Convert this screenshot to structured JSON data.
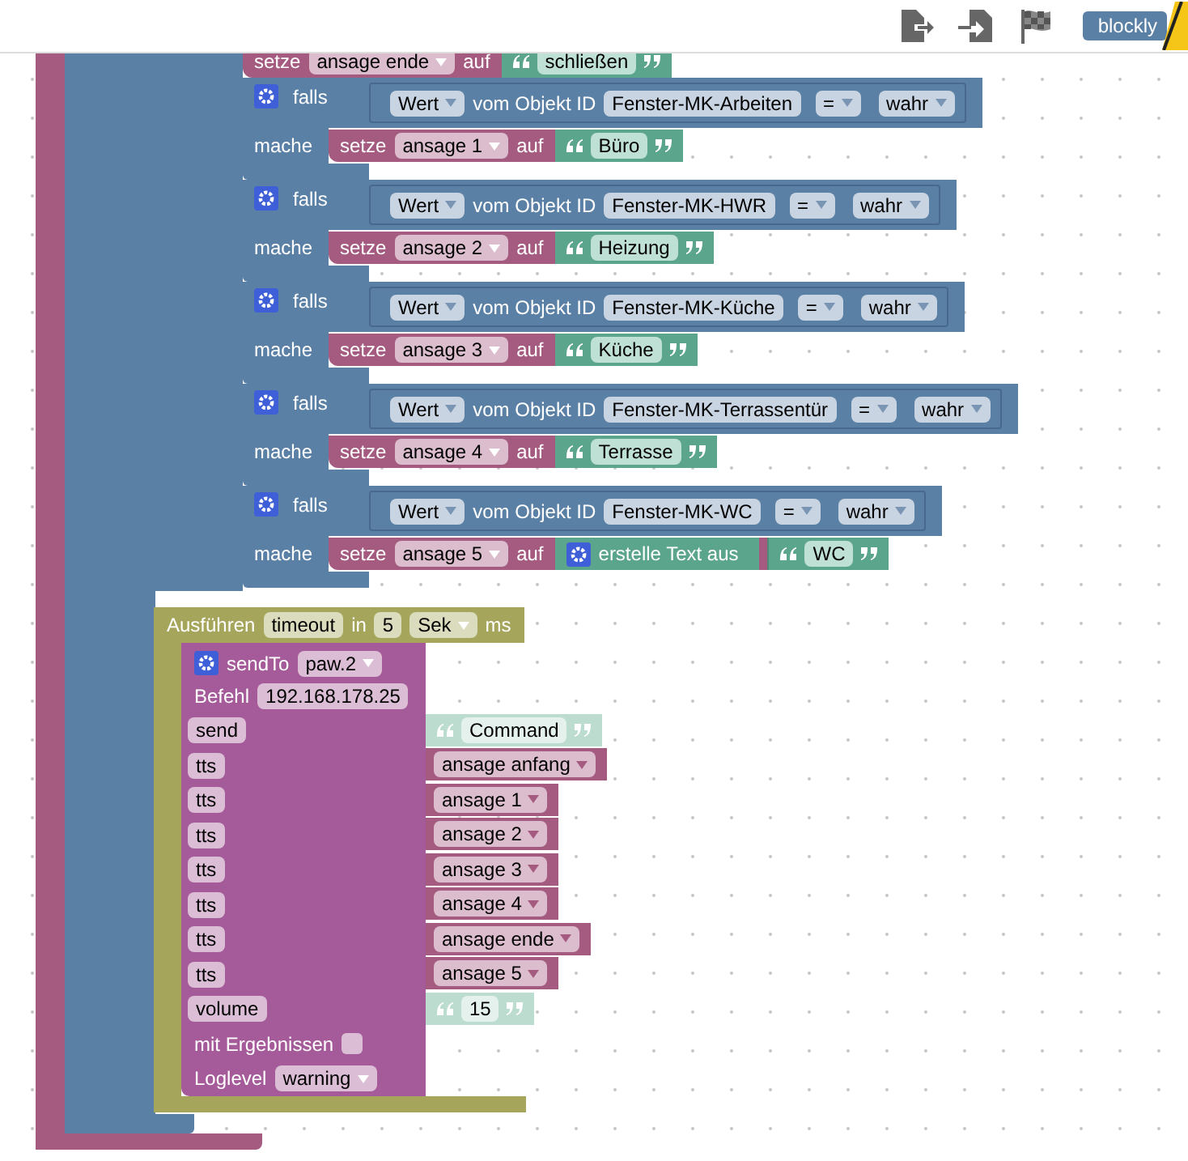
{
  "toolbar": {
    "badge": "blockly"
  },
  "partial_block": {
    "verb": "setze",
    "variable": "ansage ende",
    "to": "auf",
    "text": "schließen"
  },
  "conditions": [
    {
      "kind": "text",
      "label": "falls",
      "property": "Wert",
      "object_label": "vom Objekt ID",
      "object": "Fenster-MK-Arbeiten",
      "op": "=",
      "value": "wahr",
      "do_label": "mache",
      "verb": "setze",
      "variable": "ansage 1",
      "to": "auf",
      "text": "Büro"
    },
    {
      "kind": "text",
      "label": "falls",
      "property": "Wert",
      "object_label": "vom Objekt ID",
      "object": "Fenster-MK-HWR",
      "op": "=",
      "value": "wahr",
      "do_label": "mache",
      "verb": "setze",
      "variable": "ansage 2",
      "to": "auf",
      "text": "Heizung"
    },
    {
      "kind": "text",
      "label": "falls",
      "property": "Wert",
      "object_label": "vom Objekt ID",
      "object": "Fenster-MK-Küche",
      "op": "=",
      "value": "wahr",
      "do_label": "mache",
      "verb": "setze",
      "variable": "ansage 3",
      "to": "auf",
      "text": "Küche"
    },
    {
      "kind": "text",
      "label": "falls",
      "property": "Wert",
      "object_label": "vom Objekt ID",
      "object": "Fenster-MK-Terrassentür",
      "op": "=",
      "value": "wahr",
      "do_label": "mache",
      "verb": "setze",
      "variable": "ansage 4",
      "to": "auf",
      "text": "Terrasse"
    },
    {
      "kind": "join",
      "label": "falls",
      "property": "Wert",
      "object_label": "vom Objekt ID",
      "object": "Fenster-MK-WC",
      "op": "=",
      "value": "wahr",
      "do_label": "mache",
      "verb": "setze",
      "variable": "ansage 5",
      "to": "auf",
      "join_label": "erstelle Text aus",
      "text": "WC"
    }
  ],
  "timeout": {
    "label": "Ausführen",
    "name": "timeout",
    "in": "in",
    "amount": "5",
    "unit": "Sek",
    "suffix": "ms"
  },
  "send_to": {
    "label": "sendTo",
    "instance": "paw.2",
    "command_label": "Befehl",
    "command": "192.168.178.25",
    "params": [
      {
        "name": "send",
        "kind": "text",
        "value": "Command"
      },
      {
        "name": "tts",
        "kind": "variable",
        "value": "ansage anfang"
      },
      {
        "name": "tts",
        "kind": "variable",
        "value": "ansage 1"
      },
      {
        "name": "tts",
        "kind": "variable",
        "value": "ansage 2"
      },
      {
        "name": "tts",
        "kind": "variable",
        "value": "ansage 3"
      },
      {
        "name": "tts",
        "kind": "variable",
        "value": "ansage 4"
      },
      {
        "name": "tts",
        "kind": "variable",
        "value": "ansage ende"
      },
      {
        "name": "tts",
        "kind": "variable",
        "value": "ansage 5"
      },
      {
        "name": "volume",
        "kind": "text",
        "value": "15"
      }
    ],
    "results_label": "mit Ergebnissen",
    "results_checked": false,
    "loglevel_label": "Loglevel",
    "loglevel": "warning"
  }
}
